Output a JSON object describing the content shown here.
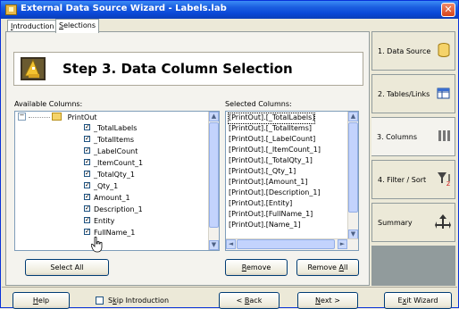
{
  "window": {
    "title": "External Data Source Wizard - Labels.lab",
    "close_glyph": "✕"
  },
  "tabs": [
    {
      "label": "Introduction",
      "underline": "I",
      "rest": "ntroduction"
    },
    {
      "label": "Selections",
      "underline": "S",
      "rest": "elections"
    }
  ],
  "header": {
    "title": "Step 3. Data Column Selection",
    "icon": "wizard-hat-icon"
  },
  "available": {
    "label": "Available Columns:",
    "root": "PrintOut",
    "items": [
      "_TotalLabels",
      "_TotalItems",
      "_LabelCount",
      "_ItemCount_1",
      "_TotalQty_1",
      "_Qty_1",
      "Amount_1",
      "Description_1",
      "Entity",
      "FullName_1"
    ]
  },
  "selected": {
    "label": "Selected Columns:",
    "items": [
      "[PrintOut].[_TotalLabels]",
      "[PrintOut].[_TotalItems]",
      "[PrintOut].[_LabelCount]",
      "[PrintOut].[_ItemCount_1]",
      "[PrintOut].[_TotalQty_1]",
      "[PrintOut].[_Qty_1]",
      "[PrintOut].[Amount_1]",
      "[PrintOut].[Description_1]",
      "[PrintOut].[Entity]",
      "[PrintOut].[FullName_1]",
      "[PrintOut].[Name_1]"
    ]
  },
  "buttons": {
    "select_all": "Select All",
    "remove_underline": "R",
    "remove_rest": "emove",
    "remove_all_pre": "Remove ",
    "remove_all_underline": "A",
    "remove_all_rest": "ll"
  },
  "nav": [
    {
      "label": "1. Data Source",
      "icon": "database-icon",
      "active": false
    },
    {
      "label": "2. Tables/Links",
      "icon": "table-link-icon",
      "active": false
    },
    {
      "label": "3. Columns",
      "icon": "columns-icon",
      "active": true
    },
    {
      "label": "4. Filter / Sort",
      "icon": "filter-sort-icon",
      "active": false
    },
    {
      "label": "Summary",
      "icon": "summary-icon",
      "active": false
    }
  ],
  "footer": {
    "help_u": "H",
    "help_rest": "elp",
    "skip_pre": "S",
    "skip_u": "k",
    "skip_rest": "ip Introduction",
    "back_pre": "< ",
    "back_u": "B",
    "back_rest": "ack",
    "next_u": "N",
    "next_rest": "ext >",
    "exit_pre": "E",
    "exit_u": "x",
    "exit_rest": "it Wizard"
  },
  "colors": {
    "title_bar": "#0a48d8",
    "selection_highlight": "#316ac5",
    "face": "#ece9d8"
  }
}
